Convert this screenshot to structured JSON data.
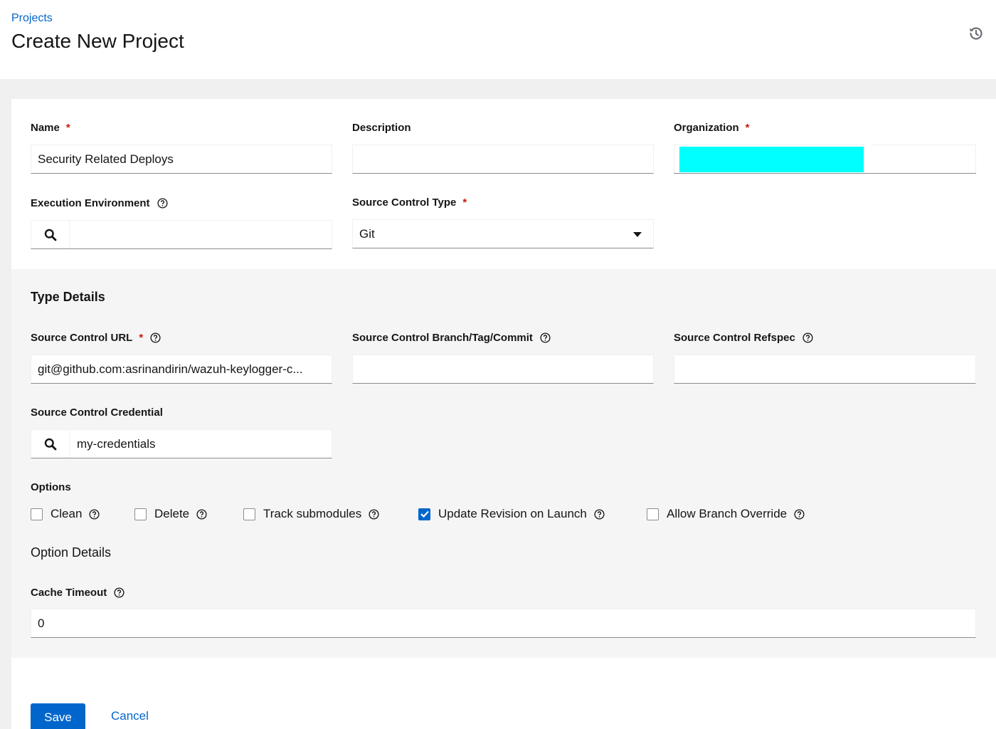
{
  "header": {
    "breadcrumb": "Projects",
    "title": "Create New Project"
  },
  "form": {
    "name": {
      "label": "Name",
      "required": "*",
      "value": "Security Related Deploys"
    },
    "description": {
      "label": "Description",
      "value": ""
    },
    "organization": {
      "label": "Organization",
      "required": "*",
      "redaction_color": "#00ffff"
    },
    "execution_environment": {
      "label": "Execution Environment",
      "value": ""
    },
    "source_control_type": {
      "label": "Source Control Type",
      "required": "*",
      "value": "Git"
    }
  },
  "type_details": {
    "title": "Type Details",
    "url": {
      "label": "Source Control URL",
      "required": "*",
      "value": "git@github.com:asrinandirin/wazuh-keylogger-c..."
    },
    "branch": {
      "label": "Source Control Branch/Tag/Commit",
      "value": ""
    },
    "refspec": {
      "label": "Source Control Refspec",
      "value": ""
    },
    "credential": {
      "label": "Source Control Credential",
      "value": "my-credentials"
    },
    "options_label": "Options",
    "options": [
      {
        "label": "Clean",
        "checked": false
      },
      {
        "label": "Delete",
        "checked": false
      },
      {
        "label": "Track submodules",
        "checked": false
      },
      {
        "label": "Update Revision on Launch",
        "checked": true
      },
      {
        "label": "Allow Branch Override",
        "checked": false
      }
    ],
    "option_details_title": "Option Details",
    "cache_timeout": {
      "label": "Cache Timeout",
      "value": "0"
    }
  },
  "actions": {
    "save": "Save",
    "cancel": "Cancel"
  },
  "colors": {
    "primary": "#0066cc",
    "required": "#c9190b",
    "text": "#151515"
  },
  "icons": {
    "history": "history-icon",
    "help": "help-circle-icon",
    "search": "search-icon",
    "caret": "caret-down-icon",
    "check": "check-icon"
  }
}
